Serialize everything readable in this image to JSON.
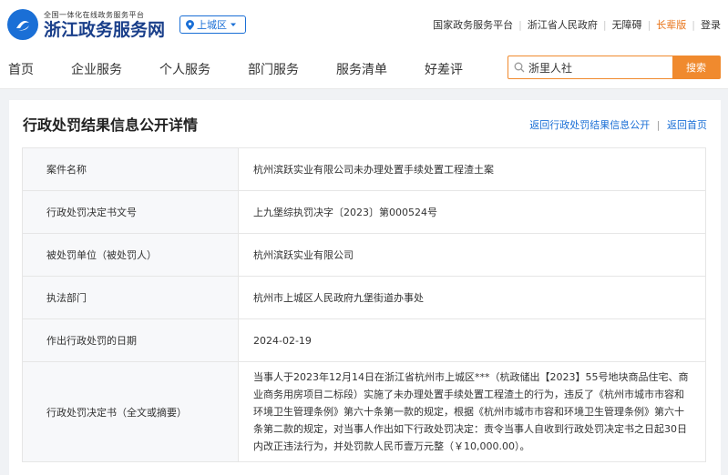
{
  "header": {
    "logo_subtitle": "全国一体化在线政务服务平台",
    "logo_title": "浙江政务服务网",
    "region": "上城区"
  },
  "top_links": [
    "国家政务服务平台",
    "浙江省人民政府",
    "无障碍",
    "长辈版",
    "登录"
  ],
  "nav": {
    "items": [
      "首页",
      "企业服务",
      "个人服务",
      "部门服务",
      "服务清单",
      "好差评"
    ],
    "search_value": "浙里人社",
    "search_button": "搜索"
  },
  "page": {
    "title": "行政处罚结果信息公开详情",
    "back_link_1": "返回行政处罚结果信息公开",
    "back_link_2": "返回首页"
  },
  "details": [
    {
      "label": "案件名称",
      "value": "杭州滨跃实业有限公司未办理处置手续处置工程渣土案"
    },
    {
      "label": "行政处罚决定书文号",
      "value": "上九堡综执罚决字〔2023〕第000524号"
    },
    {
      "label": "被处罚单位（被处罚人）",
      "value": "杭州滨跃实业有限公司"
    },
    {
      "label": "执法部门",
      "value": "杭州市上城区人民政府九堡街道办事处"
    },
    {
      "label": "作出行政处罚的日期",
      "value": "2024-02-19"
    },
    {
      "label": "行政处罚决定书（全文或摘要）",
      "value": "当事人于2023年12月14日在浙江省杭州市上城区***（杭政储出【2023】55号地块商品住宅、商业商务用房项目二标段）实施了未办理处置手续处置工程渣土的行为，违反了《杭州市城市市容和环境卫生管理条例》第六十条第一款的规定，根据《杭州市城市市容和环境卫生管理条例》第六十条第二款的规定，对当事人作出如下行政处罚决定：责令当事人自收到行政处罚决定书之日起30日内改正违法行为，并处罚款人民币壹万元整（￥10,000.00）。"
    }
  ],
  "colors": {
    "brand_blue": "#1a6fd6",
    "accent_orange": "#f08a2e"
  }
}
